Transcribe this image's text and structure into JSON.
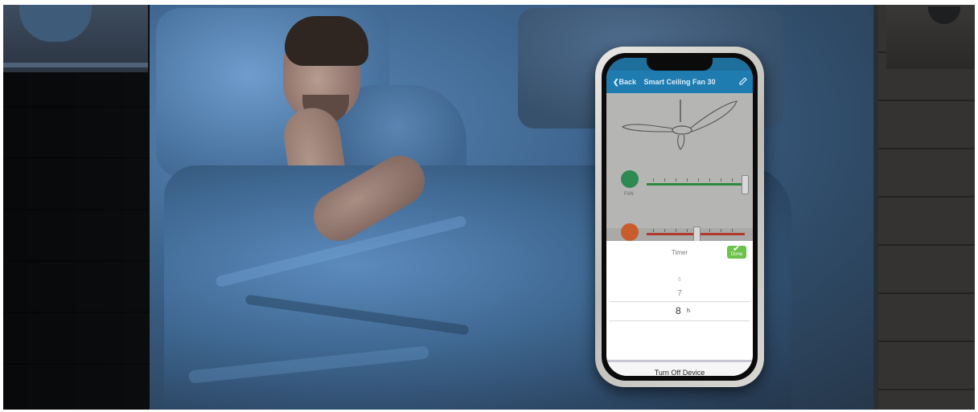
{
  "app": {
    "nav": {
      "back_label": "Back",
      "title": "Smart Ceiling Fan 30"
    },
    "controls": {
      "fan_label": "FAN"
    },
    "timer_sheet": {
      "label": "Timer",
      "ok_label": "Done",
      "picker": {
        "above_above": "6",
        "above": "7",
        "selected": "8",
        "unit": "h"
      },
      "turn_off_label": "Turn Off Device"
    }
  },
  "colors": {
    "nav_blue": "#1f7cb0",
    "fan_green": "#2c8a3c",
    "light_red": "#b03a2e",
    "ok_green": "#6cc24a"
  },
  "icons": [
    "chevron-left-icon",
    "edit-icon",
    "ceiling-fan-icon",
    "fan-icon",
    "light-icon",
    "checkmark-icon"
  ]
}
